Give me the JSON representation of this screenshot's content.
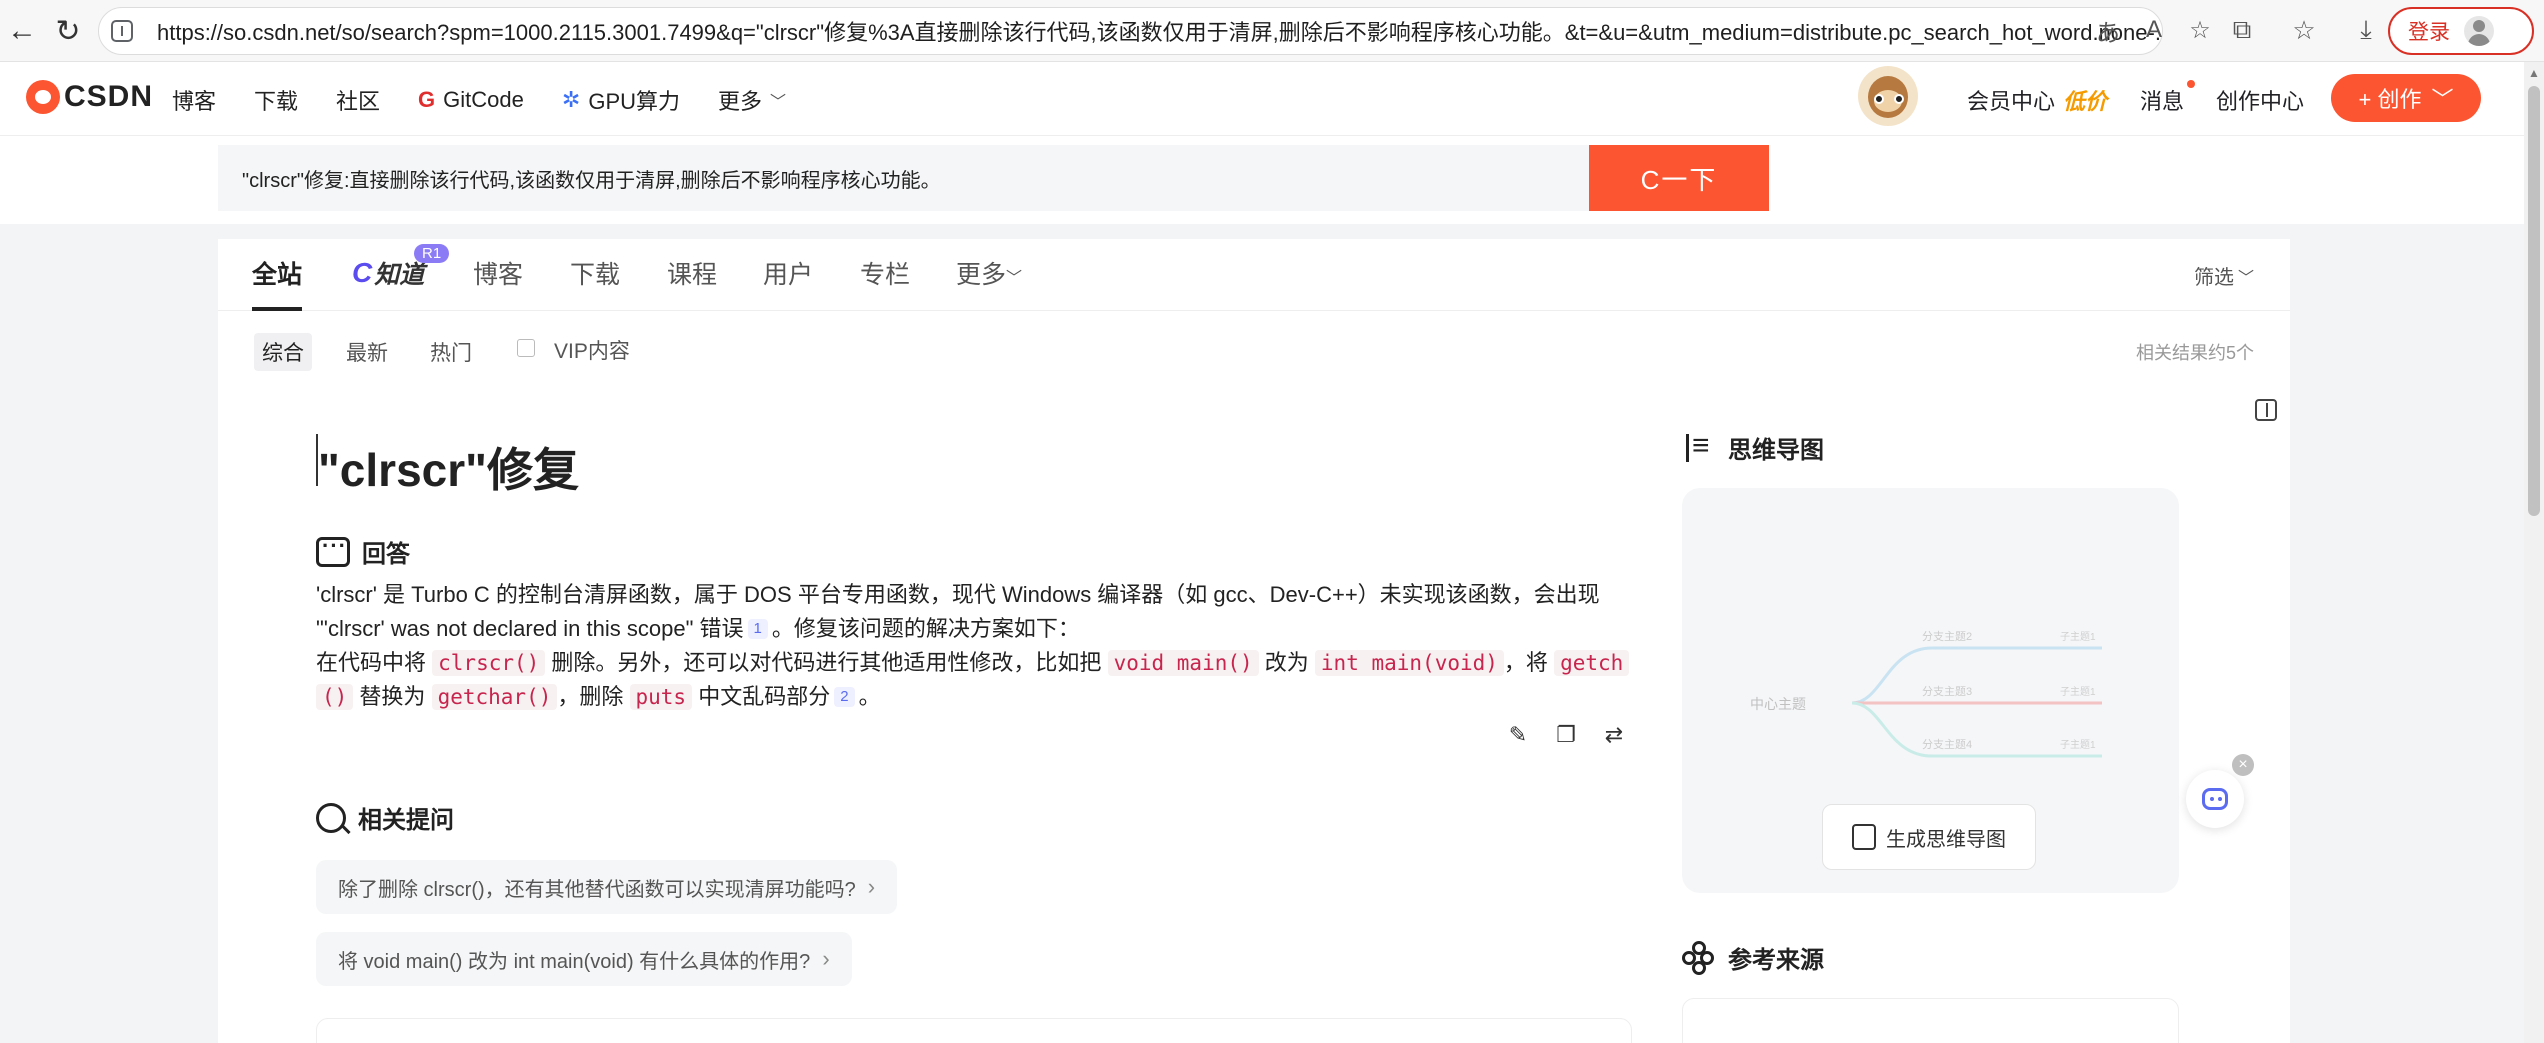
{
  "browser": {
    "url": "https://so.csdn.net/so/search?spm=1000.2115.3001.7499&q=\"clrscr\"修复%3A直接删除该行代码,该函数仅用于清屏,删除后不影响程序核心功能。&t=&u=&utm_medium=distribute.pc_search_hot_word.none-...",
    "login_label": "登录",
    "address_icons": [
      "read-aloud-icon",
      "text-size-icon",
      "star-icon"
    ],
    "toolbar_icons": [
      "extensions-icon",
      "favorites-icon",
      "download-icon"
    ]
  },
  "csdn_nav": {
    "logo_text": "CSDN",
    "items": [
      "博客",
      "下载",
      "社区",
      "GitCode",
      "GPU算力",
      "更多"
    ],
    "vip_label": "会员中心",
    "vip_badge": "低价",
    "messages_label": "消息",
    "create_center_label": "创作中心",
    "create_button_label": "+ 创作"
  },
  "search": {
    "query": "\"clrscr\"修复:直接删除该行代码,该函数仅用于清屏,删除后不影响程序核心功能。",
    "button_label": "C一下"
  },
  "tabs": {
    "main": [
      "全站",
      "知道",
      "博客",
      "下载",
      "课程",
      "用户",
      "专栏",
      "更多"
    ],
    "badge": "R1",
    "filter_label": "筛选",
    "sub": [
      "综合",
      "最新",
      "热门"
    ],
    "vip_filter_label": "VIP内容",
    "result_count": "相关结果约5个"
  },
  "result": {
    "title": "\"clrscr\"修复",
    "answer_heading": "回答",
    "answer_line1_a": "'clrscr' 是 Turbo C 的控制台清屏函数，属于 DOS 平台专用函数，现代 Windows 编译器（如 gcc、Dev-C++）未实现该函数，会出现",
    "answer_line2_a": "\"'clrscr' was not declared in this scope\" 错误",
    "answer_line2_b": "。修复该问题的解决方案如下：",
    "answer_line3_a": "在代码中将",
    "answer_line3_b": "删除。另外，还可以对代码进行其他适用性修改，比如把",
    "answer_line3_c": "改为",
    "answer_line3_d": "，将",
    "answer_line4_a": "替换为",
    "answer_line4_b": "，删除",
    "answer_line4_c": "中文乱码部分",
    "answer_line4_d": "。",
    "code_clrscr": "clrscr()",
    "code_void_main": "void main()",
    "code_int_main": "int main(void)",
    "code_getch_part1": "getch",
    "code_getch_part2": "()",
    "code_getchar": "getchar()",
    "code_puts": "puts",
    "cite1": "1",
    "cite2": "2",
    "related_heading": "相关提问",
    "related": [
      "除了删除 clrscr()，还有其他替代函数可以实现清屏功能吗?",
      "将 void main() 改为 int main(void) 有什么具体的作用?"
    ]
  },
  "sidebar": {
    "mindmap_heading": "思维导图",
    "mindmap_center": "中心主题",
    "mindmap_branches": [
      "分支主题2",
      "分支主题3",
      "分支主题4"
    ],
    "mindmap_sub": [
      "子主题1",
      "子主题1",
      "子主题1"
    ],
    "mindmap_button": "生成思维导图",
    "references_heading": "参考来源"
  },
  "colors": {
    "brand": "#fc5531",
    "code_text": "#c7254e",
    "cite": "#5b6cf0"
  }
}
